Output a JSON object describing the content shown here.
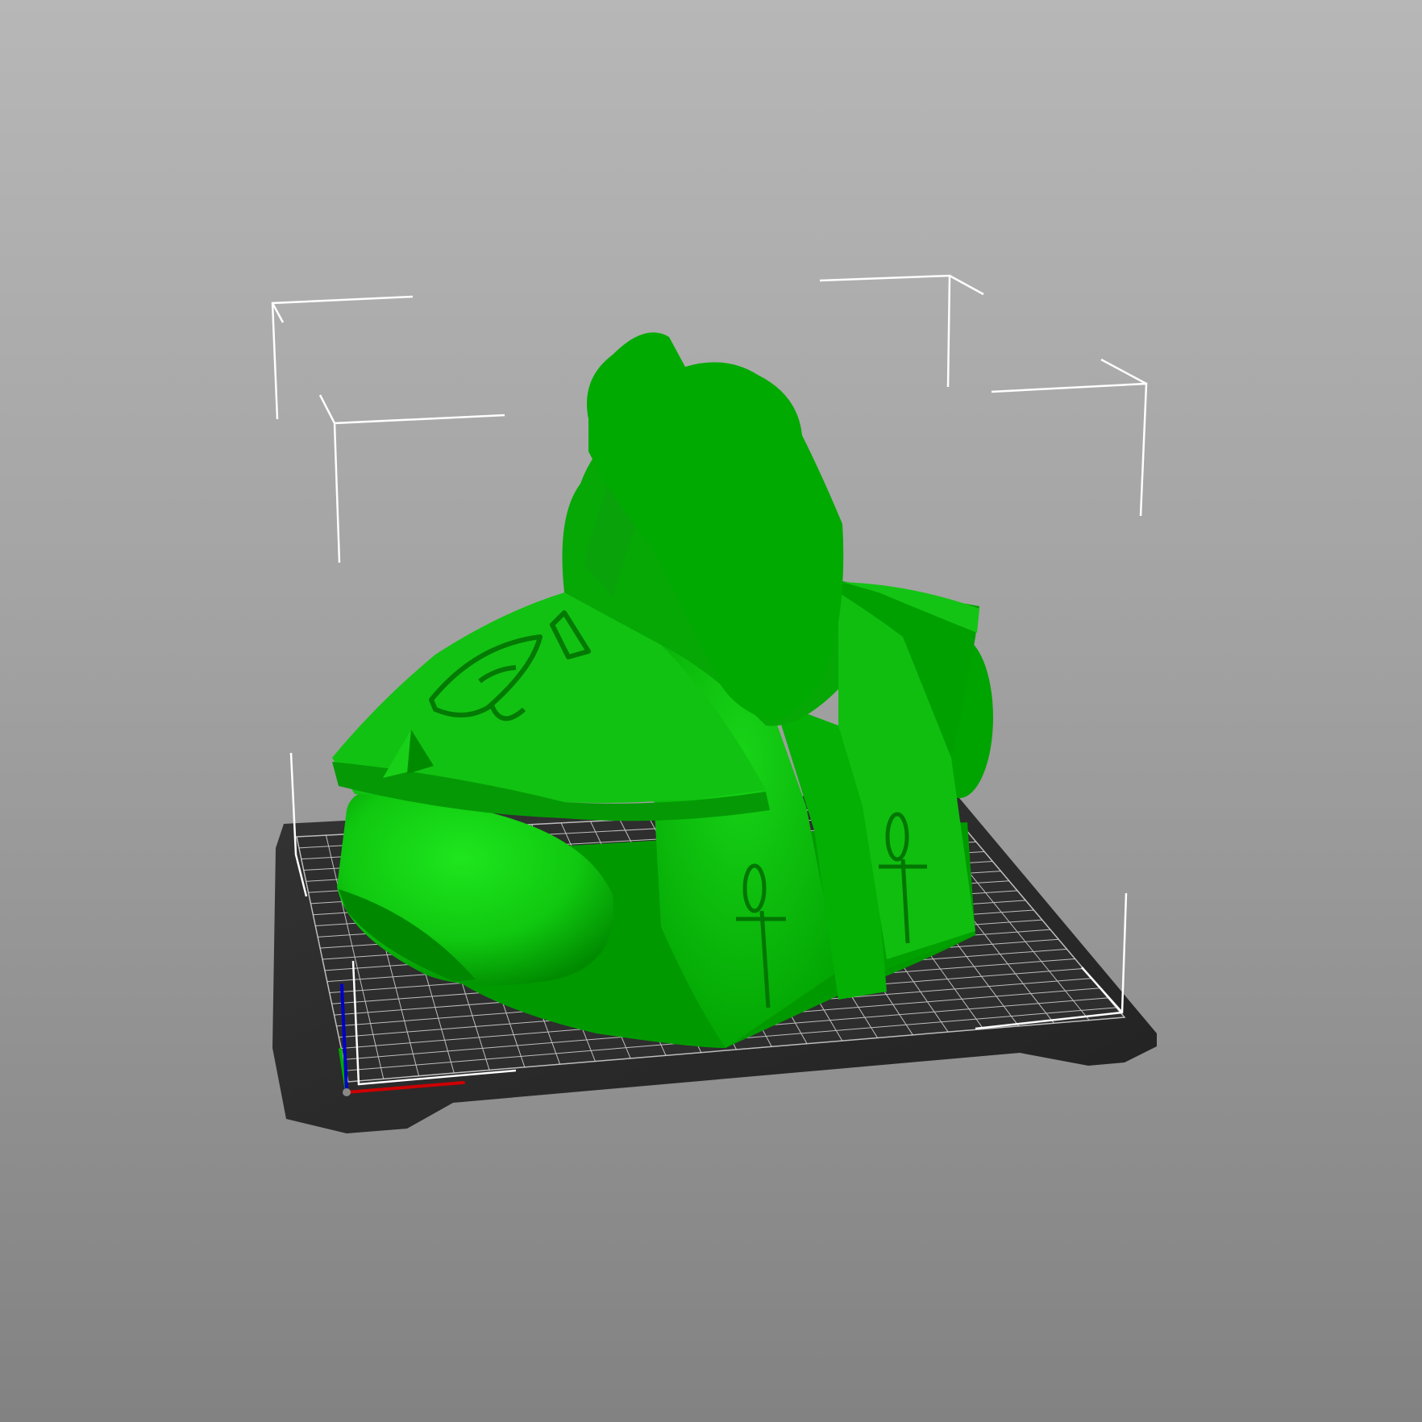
{
  "scene": {
    "background_top": "#b7b7b7",
    "background_bottom": "#828282",
    "model_color": "#00b000",
    "model_highlight": "#1ee61e",
    "model_shadow": "#008a00",
    "bed_color": "#2a2a2a",
    "grid_color": "#d8d8d8",
    "bounding_box_color": "#ffffff"
  },
  "model": {
    "icon": "egyptian-bust-model",
    "emblems": [
      "eye-of-horus-icon",
      "ankh-icon",
      "ankh-icon",
      "pyramid-icon"
    ]
  },
  "axes": {
    "x_color": "#cc0000",
    "y_color": "#00aa00",
    "z_color": "#0000cc"
  }
}
